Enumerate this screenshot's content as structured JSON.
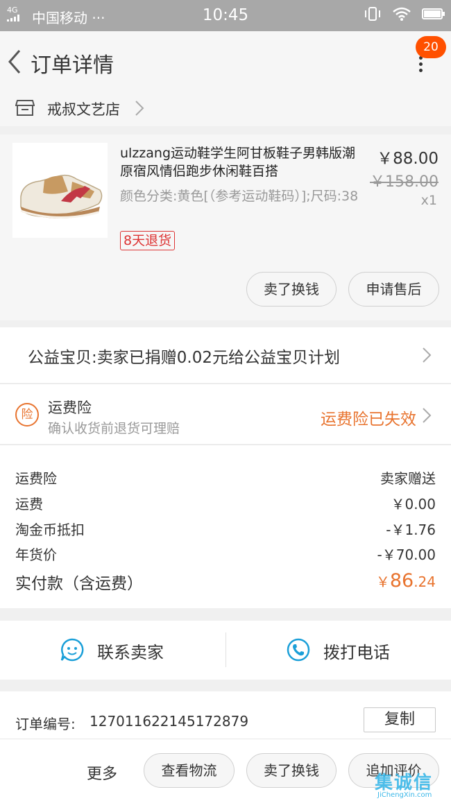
{
  "status_bar": {
    "network": "4G",
    "carrier": "中国移动",
    "dots": "···",
    "time": "10:45"
  },
  "nav": {
    "title": "订单详情",
    "badge_count": "20"
  },
  "shop": {
    "name": "戒叔文艺店"
  },
  "product": {
    "title": "ulzzang运动鞋学生阿甘板鞋子男韩版潮原宿风情侣跑步休闲鞋百搭",
    "sku": "颜色分类:黄色[（参考运动鞋码）];尺码:38",
    "tag": "8天退货",
    "price": "￥88.00",
    "original_price": "￥158.00",
    "quantity": "x1",
    "sell_button": "卖了换钱",
    "after_sale_button": "申请售后"
  },
  "charity": {
    "text": "公益宝贝:卖家已捐赠0.02元给公益宝贝计划"
  },
  "insurance": {
    "badge": "险",
    "title": "运费险",
    "subtitle": "确认收货前退货可理赔",
    "status": "运费险已失效"
  },
  "fees": [
    {
      "label": "运费险",
      "value": "卖家赠送"
    },
    {
      "label": "运费",
      "value": "￥0.00"
    },
    {
      "label": "淘金币抵扣",
      "value": "-￥1.76"
    },
    {
      "label": "年货价",
      "value": "-￥70.00"
    }
  ],
  "total": {
    "label": "实付款（含运费）",
    "currency": "￥",
    "integer": "86",
    "decimal": ".24"
  },
  "contact": {
    "seller_label": "联系卖家",
    "phone_label": "拨打电话"
  },
  "order": {
    "label": "订单编号:",
    "number": "127011622145172879",
    "copy_button": "复制"
  },
  "bottom_bar": {
    "more_label": "更多",
    "logistics_button": "查看物流",
    "sell_button": "卖了换钱",
    "review_button": "追加评价"
  },
  "watermark": {
    "big": "集诚信",
    "small": "JiChengXin.com"
  },
  "colors": {
    "accent_orange": "#e8732e",
    "badge_red": "#ff5000",
    "contact_blue": "#1a9fd8"
  }
}
